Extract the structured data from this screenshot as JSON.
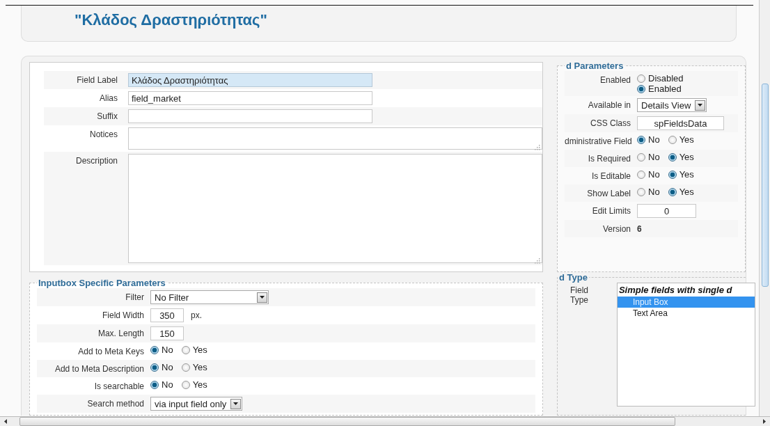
{
  "page_title": "\"Κλάδος Δραστηριότητας\"",
  "basic_fields": [
    {
      "label": "Field Label",
      "kind": "text",
      "value": "Κλάδος Δραστηριότητας",
      "focused": true
    },
    {
      "label": "Alias",
      "kind": "text",
      "value": "field_market",
      "focused": false
    },
    {
      "label": "Suffix",
      "kind": "text",
      "focused": false
    },
    {
      "label": "Notices",
      "kind": "textarea"
    },
    {
      "label": "Description",
      "kind": "editor"
    }
  ],
  "params": {
    "legend": "d Parameters",
    "rows": [
      {
        "label": "Enabled",
        "kind": "radio",
        "options": [
          {
            "label": "Disabled",
            "selected": false
          },
          {
            "label": "Enabled",
            "selected": true
          }
        ]
      },
      {
        "label": "Available in",
        "kind": "select",
        "value": "Details View"
      },
      {
        "label": "CSS Class",
        "kind": "text",
        "value": "spFieldsData"
      },
      {
        "label": "dministrative Field",
        "kind": "radio",
        "options": [
          {
            "label": "No",
            "selected": true
          },
          {
            "label": "Yes",
            "selected": false
          }
        ]
      },
      {
        "label": "Is Required",
        "kind": "radio",
        "options": [
          {
            "label": "No",
            "selected": false
          },
          {
            "label": "Yes",
            "selected": true
          }
        ]
      },
      {
        "label": "Is Editable",
        "kind": "radio",
        "options": [
          {
            "label": "No",
            "selected": false
          },
          {
            "label": "Yes",
            "selected": true
          }
        ]
      },
      {
        "label": "Show Label",
        "kind": "radio",
        "options": [
          {
            "label": "No",
            "selected": false
          },
          {
            "label": "Yes",
            "selected": true
          }
        ]
      },
      {
        "label": "Edit Limits",
        "kind": "number",
        "value": "0"
      },
      {
        "label": "Version",
        "kind": "static",
        "value": "6"
      }
    ]
  },
  "inputbox": {
    "legend": "Inputbox Specific Parameters",
    "rows": [
      {
        "label": "Filter",
        "kind": "select",
        "value": "No Filter"
      },
      {
        "label": "Field Width",
        "kind": "number",
        "value": "350",
        "unit": "px."
      },
      {
        "label": "Max. Length",
        "kind": "number",
        "value": "150"
      },
      {
        "label": "Add to Meta Keys",
        "kind": "radio",
        "options": [
          {
            "label": "No",
            "selected": true
          },
          {
            "label": "Yes",
            "selected": false
          }
        ]
      },
      {
        "label": "Add to Meta Description",
        "kind": "radio",
        "options": [
          {
            "label": "No",
            "selected": true
          },
          {
            "label": "Yes",
            "selected": false
          }
        ]
      },
      {
        "label": "Is searchable",
        "kind": "radio",
        "options": [
          {
            "label": "No",
            "selected": true
          },
          {
            "label": "Yes",
            "selected": false
          }
        ]
      },
      {
        "label": "Search method",
        "kind": "select",
        "value": "via input field only"
      }
    ]
  },
  "field_type": {
    "legend": "d Type",
    "label": "Field Type",
    "group": "Simple fields with single d",
    "options": [
      {
        "label": "Input Box",
        "selected": true
      },
      {
        "label": "Text Area",
        "selected": false
      }
    ]
  }
}
